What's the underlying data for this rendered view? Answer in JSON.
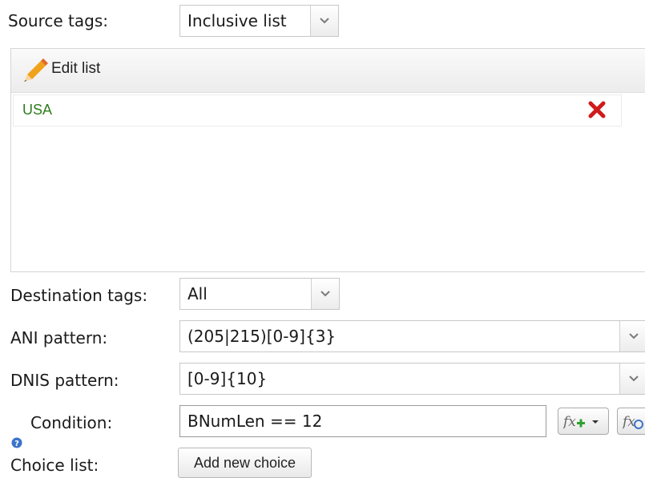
{
  "source_tags": {
    "label": "Source tags:",
    "value": "Inclusive list",
    "edit_label": "Edit list",
    "items": [
      "USA"
    ]
  },
  "destination_tags": {
    "label": "Destination tags:",
    "value": "All"
  },
  "ani_pattern": {
    "label": "ANI pattern:",
    "value": "(205|215)[0-9]{3}"
  },
  "dnis_pattern": {
    "label": "DNIS pattern:",
    "value": "[0-9]{10}"
  },
  "condition": {
    "label": "Condition:",
    "value": "BNumLen == 12"
  },
  "choice_list": {
    "label": "Choice list:",
    "button": "Add new choice"
  },
  "colors": {
    "tag_text": "#2f7d1f",
    "delete": "#d11a1a",
    "info": "#3b73c9"
  }
}
